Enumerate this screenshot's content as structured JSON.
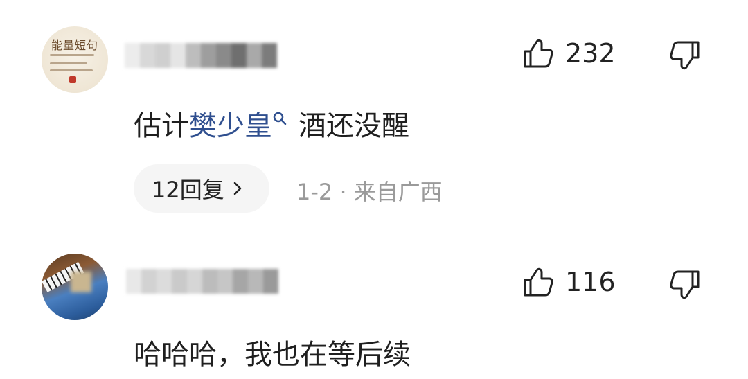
{
  "comments": [
    {
      "avatar_text": "能量短句",
      "likes": "232",
      "content_prefix": "估计",
      "content_link": "樊少皇",
      "content_suffix": "酒还没醒",
      "replies_label": "12回复",
      "meta": "1-2 · 来自广西"
    },
    {
      "likes": "116",
      "content": "哈哈哈，我也在等后续"
    }
  ],
  "icons": {
    "like": "thumbs-up-icon",
    "dislike": "thumbs-down-icon",
    "search": "search-icon",
    "chevron": "chevron-right-icon"
  },
  "colors": {
    "link": "#2f4f8f",
    "meta": "#9a9a9a",
    "reply_bg": "#f5f5f5"
  }
}
